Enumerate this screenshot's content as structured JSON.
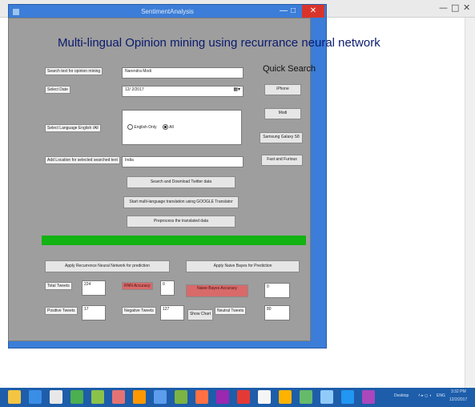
{
  "window": {
    "title": "SentimentAnalysis",
    "min": "—",
    "max": "□",
    "close": "✕"
  },
  "bg_window": {
    "min": "—",
    "max": "□",
    "close": "✕"
  },
  "heading": "Multi-lingual Opinion mining using recurrance neural network",
  "labels": {
    "search_text": "Search text for opinion mining",
    "select_date": "Select Date",
    "select_language": "Select Language English /All",
    "add_location": "Add Location for selected searched text"
  },
  "inputs": {
    "search_text": "Narendra Modi",
    "date": "12/ 2/2017",
    "location": "India"
  },
  "radios": {
    "english_only": "English Only",
    "all": "All"
  },
  "quick_search": {
    "title": "Quick Search",
    "items": [
      "iPhone",
      "Modi",
      "Samsung Galaxy S8",
      "Fast and Furious"
    ]
  },
  "actions": {
    "search_download": "Search and Download Twitter data",
    "start_translation": "Start multi-language translation using GOOGLE Translator",
    "preprocess": "Preprocess the translated data"
  },
  "progress": {
    "value": 1.0,
    "color": "#12b312"
  },
  "predict": {
    "rnn_button": "Apply Recurrence Neural Network for prediction",
    "naive_button": "Apply Naive Bayes for Prediction"
  },
  "stats": {
    "total_tweets_label": "Total Tweets",
    "total_tweets_value": "224",
    "rnn_accuracy_label": "RNN Accuracy",
    "rnn_accuracy_value": "0",
    "naive_accuracy_label": "Naive Bayes Accuracy",
    "naive_accuracy_value": "0",
    "positive_tweets_label": "Positive Tweets",
    "positive_tweets_value": "17",
    "negative_tweets_label": "Negative Tweets",
    "negative_tweets_value": "127",
    "show_chart": "Show Chart",
    "neutral_tweets_label": "Neutral Tweets",
    "neutral_tweets_value": "80"
  },
  "taskbar": {
    "desktop_label": "Desktop",
    "lang": "ENG",
    "time": "3:32 PM",
    "date": "12/2/2017"
  },
  "colors": {
    "accent_red": "#d86a6a",
    "title_blue": "#0a1a6e",
    "client_gray": "#9e9e9e"
  }
}
